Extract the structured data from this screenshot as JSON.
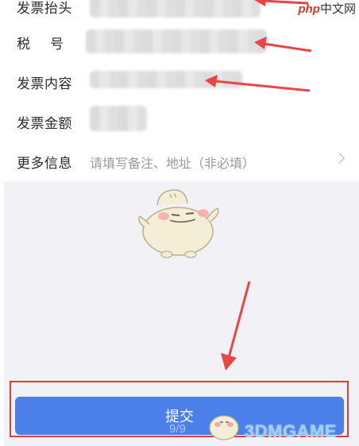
{
  "form": {
    "rows": [
      {
        "label": "发票抬头",
        "value_hidden": true
      },
      {
        "label": "税号",
        "value_hidden": true
      },
      {
        "label": "发票内容",
        "value_hidden": true
      },
      {
        "label": "发票金额",
        "value_hidden": true
      },
      {
        "label": "更多信息",
        "placeholder": "请填写备注、地址（非必填）"
      }
    ]
  },
  "submit": {
    "label": "提交"
  },
  "page_indicator": "9/9",
  "watermarks": {
    "top_brand": "php",
    "top_text": "中文网",
    "bottom_text": "3DMGAME"
  },
  "colors": {
    "primary": "#4b7fe9",
    "annotation": "#e23b3b",
    "empty_background": "#f2f2f6"
  }
}
